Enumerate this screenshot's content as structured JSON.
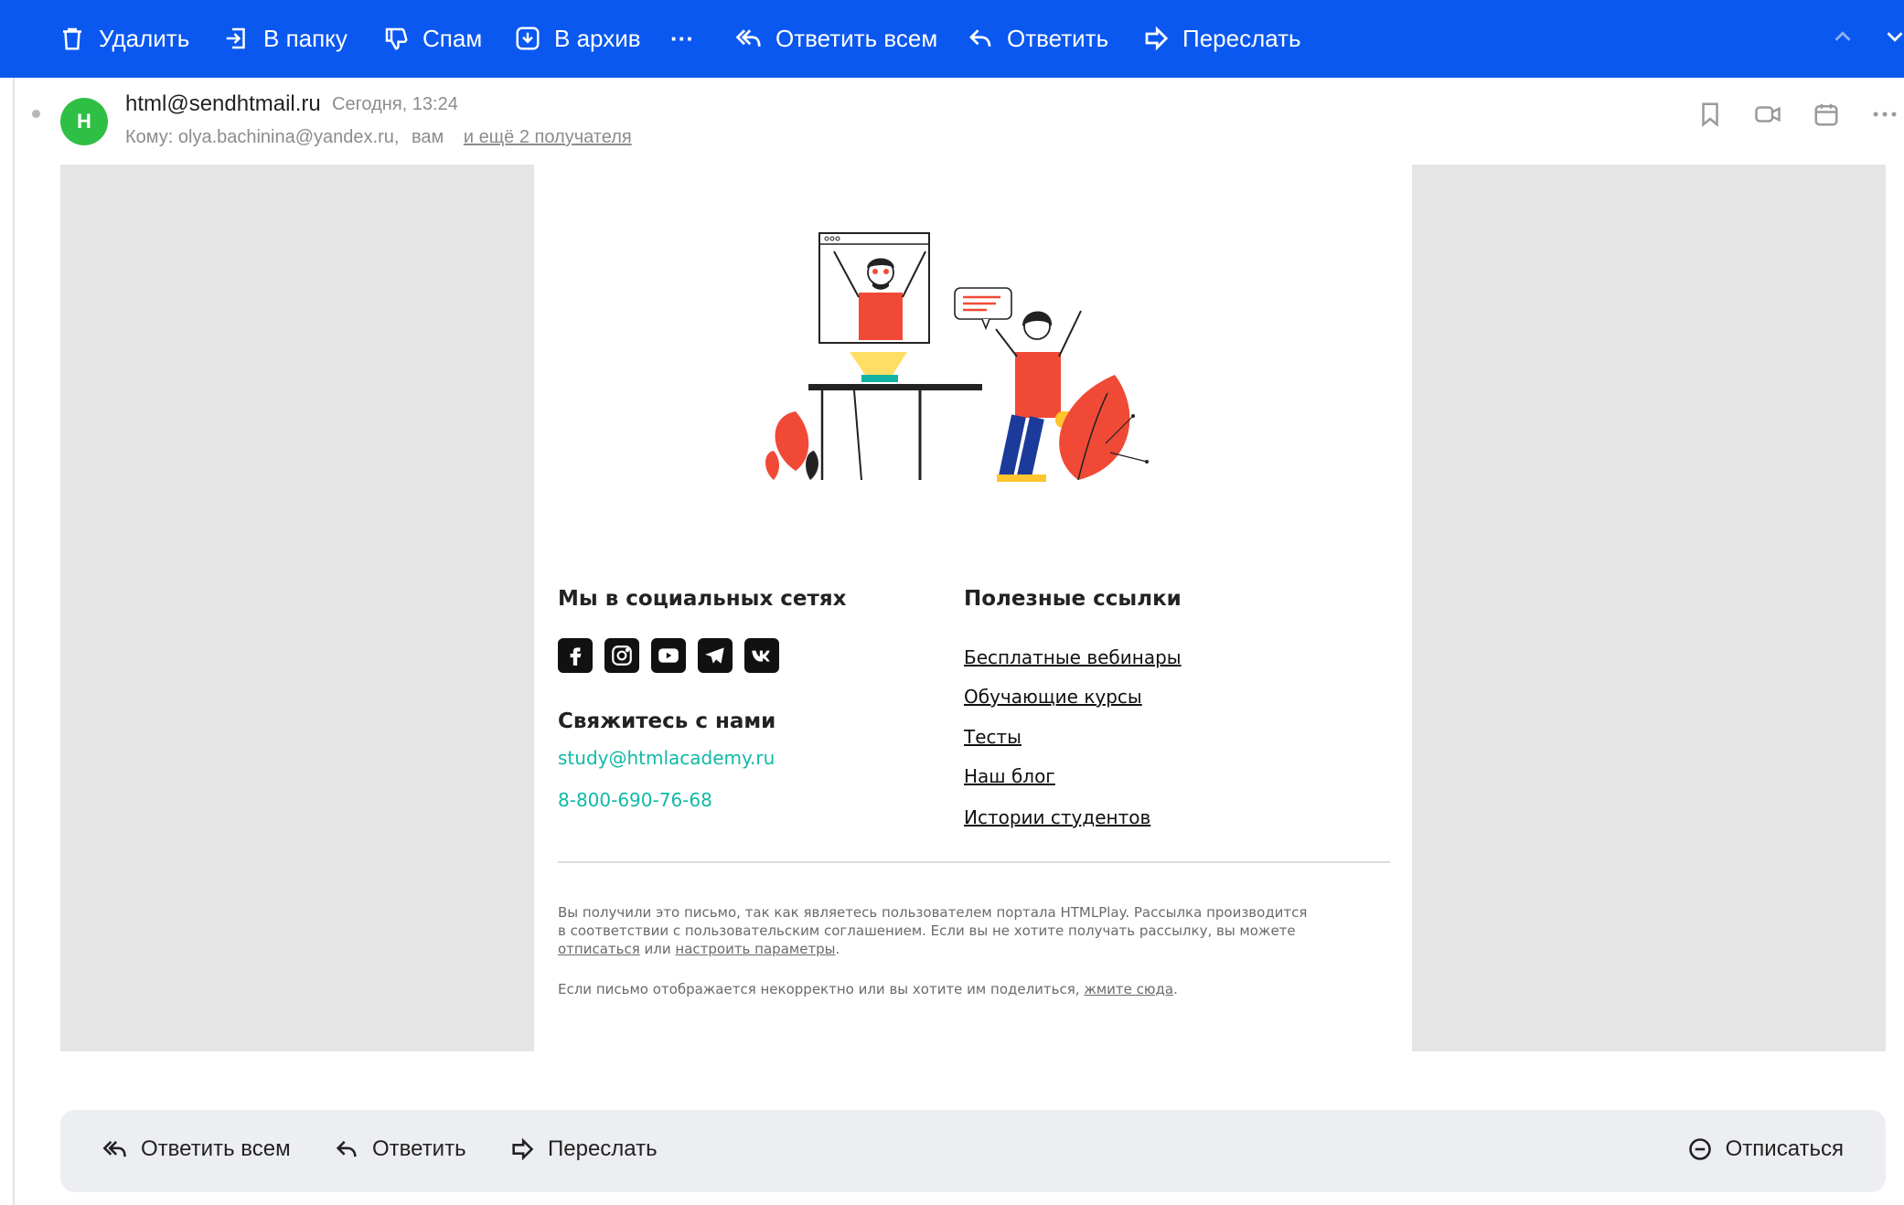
{
  "toolbar": {
    "delete": "Удалить",
    "to_folder": "В папку",
    "spam": "Спам",
    "archive": "В архив",
    "more": "···",
    "reply_all": "Ответить всем",
    "reply": "Ответить",
    "forward": "Переслать"
  },
  "message": {
    "avatar_letter": "H",
    "sender": "html@sendhtmail.ru",
    "time": "Сегодня, 13:24",
    "to_label": "Кому:",
    "to_1": "olya.bachinina@yandex.ru,",
    "to_2": "вам",
    "more_recipients": "и ещё 2 получателя"
  },
  "email": {
    "social_title": "Мы в социальных сетях",
    "contact_title": "Свяжитесь с нами",
    "email": "study@htmlacademy.ru",
    "phone": "8-800-690-76-68",
    "links_title": "Полезные ссылки",
    "links": [
      "Бесплатные вебинары",
      "Обучающие курсы",
      "Тесты",
      "Наш блог",
      "Истории студентов"
    ],
    "fine_1a": "Вы получили это письмо, так как являетесь пользователем портала HTMLPlay. Рассылка производится",
    "fine_1b": "в соответствии с пользовательским соглашением. Если вы не хотите получать рассылку, вы можете",
    "unsub_link": "отписаться",
    "or": " или ",
    "settings_link": "настроить параметры",
    "period": ".",
    "fine_2": "Если письмо отображается некорректно или вы хотите им поделиться, ",
    "here_link": "жмите сюда",
    "period2": "."
  },
  "bottom": {
    "reply_all": "Ответить всем",
    "reply": "Ответить",
    "forward": "Переслать",
    "unsubscribe": "Отписаться"
  },
  "colors": {
    "toolbar": "#0a58f0",
    "avatar": "#2fbf45",
    "teal": "#10b9a6",
    "accent_red": "#f04a36"
  }
}
